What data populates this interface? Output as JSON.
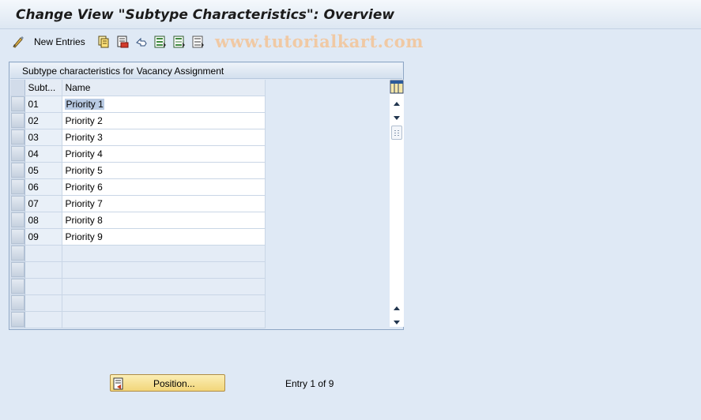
{
  "window": {
    "title": "Change View \"Subtype Characteristics\": Overview"
  },
  "toolbar": {
    "new_entries_label": "New Entries",
    "watermark": "www.tutorialkart.com",
    "icons": [
      "change-display-icon",
      "copy-icon",
      "delete-icon",
      "undo-icon",
      "select-all-icon",
      "select-block-icon",
      "deselect-all-icon"
    ]
  },
  "table_panel": {
    "title": "Subtype characteristics for Vacancy Assignment",
    "columns": [
      "Subt...",
      "Name"
    ],
    "rows": [
      {
        "code": "01",
        "name": "Priority 1"
      },
      {
        "code": "02",
        "name": "Priority 2"
      },
      {
        "code": "03",
        "name": "Priority 3"
      },
      {
        "code": "04",
        "name": "Priority 4"
      },
      {
        "code": "05",
        "name": "Priority 5"
      },
      {
        "code": "06",
        "name": "Priority 6"
      },
      {
        "code": "07",
        "name": "Priority 7"
      },
      {
        "code": "08",
        "name": "Priority 8"
      },
      {
        "code": "09",
        "name": "Priority 9"
      }
    ],
    "empty_rows": 5,
    "selected_row": 1
  },
  "footer": {
    "position_button_label": "Position...",
    "entry_info": "Entry 1 of 9"
  },
  "colors": {
    "background": "#dfe9f5",
    "button_yellow": "#f2d67a",
    "selection": "#b9cbe3"
  }
}
